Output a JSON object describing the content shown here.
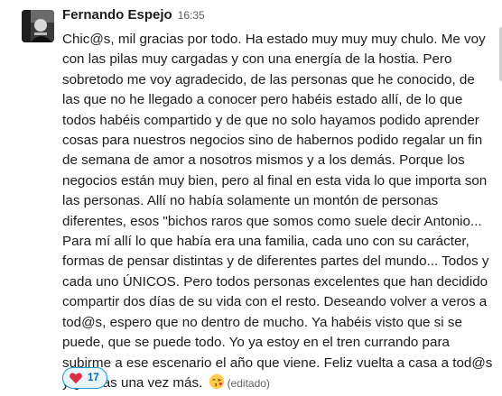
{
  "message": {
    "author": "Fernando Espejo",
    "timestamp": "16:35",
    "text": "Chic@s, mil gracias por todo. Ha estado muy muy muy chulo. Me voy con las pilas muy cargadas y con una energía de la hostia. Pero sobretodo me voy agradecido, de las personas que he conocido, de las que no he llegado a conocer pero habéis estado allí, de lo que todos habéis compartido y de que no solo hayamos podido aprender cosas para nuestros negocios sino de habernos podido regalar un fin de semana de amor a nosotros mismos y a los demás. Porque los negocios están muy bien, pero al final en esta vida lo que importa son las personas. Allí no había solamente un montón de personas diferentes, esos \"bichos raros que somos como suele decir Antonio... Para mí allí lo que había era una familia, cada uno con su carácter, formas de pensar distintas y de diferentes partes del mundo...  Todos y cada uno ÚNICOS. Pero todos personas excelentes que han decidido compartir dos días de su vida con el resto. Deseando volver a veros a tod@s, espero que no dentro de mucho. Ya habéis visto que si se puede, que se puede todo. Yo ya estoy en el tren currando para subirme a ese escenario el año que viene. Feliz vuelta a casa a tod@s y gracias una vez más.",
    "inline_emoji": "face-blowing-kiss-icon",
    "edited_label": "(editado)"
  },
  "reaction": {
    "emoji": "red-heart-icon",
    "count": "17"
  },
  "colors": {
    "text": "#1d1c1d",
    "muted": "#616061",
    "reaction_border": "#1d9bd1",
    "reaction_bg": "#e8f5fa",
    "reaction_count": "#1264a3"
  }
}
